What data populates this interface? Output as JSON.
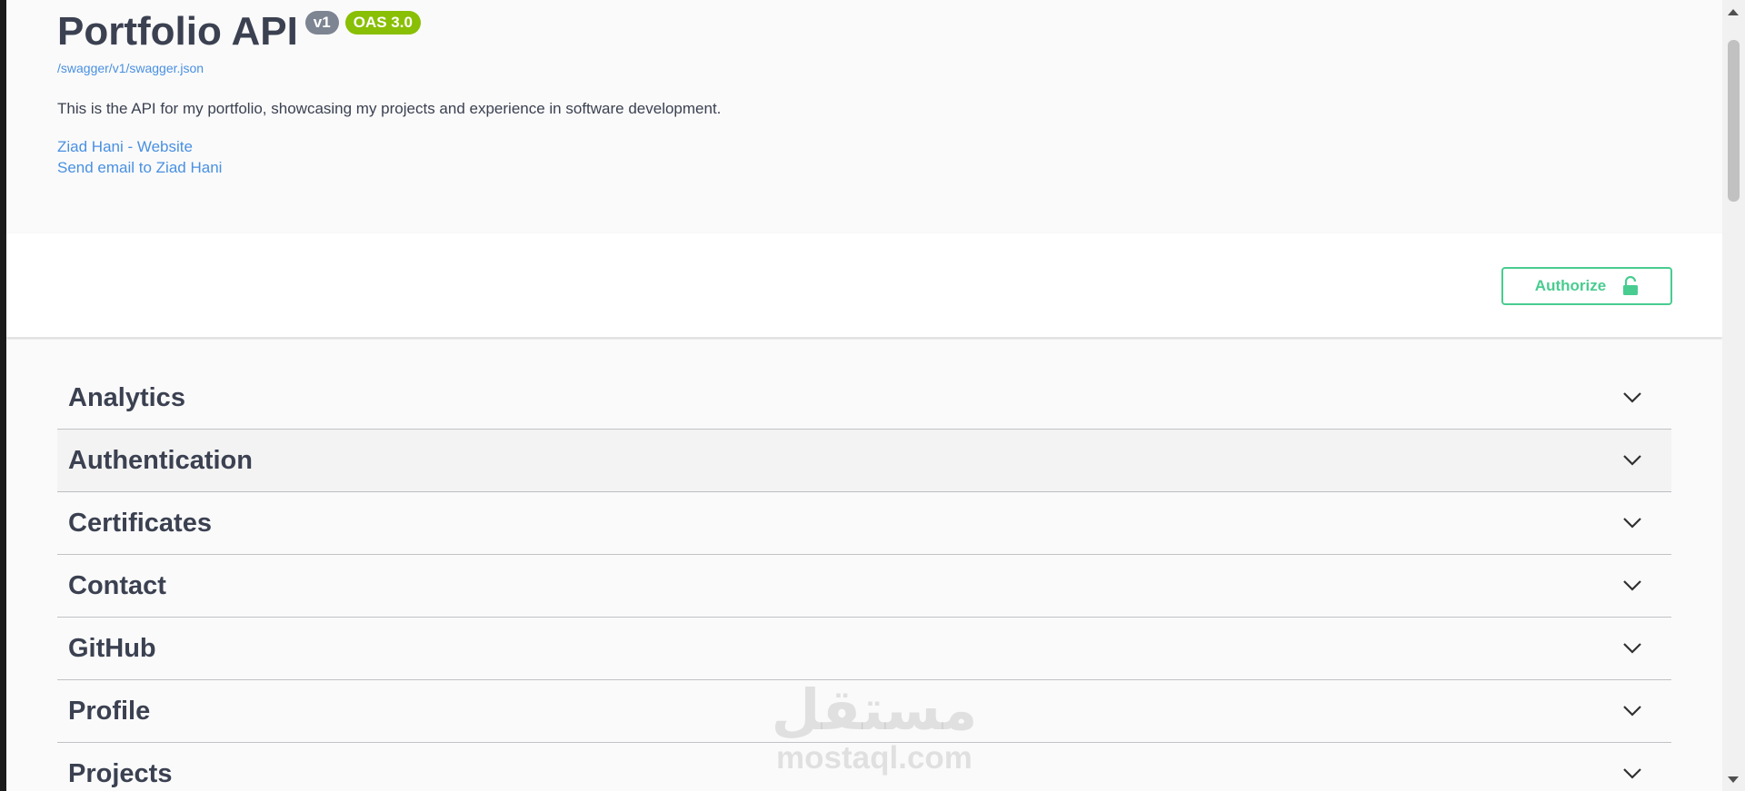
{
  "info": {
    "title": "Portfolio API",
    "version": "v1",
    "oas_version": "OAS 3.0",
    "spec_url": "/swagger/v1/swagger.json",
    "description": "This is the API for my portfolio, showcasing my projects and experience in software development.",
    "contact_website": "Ziad Hani - Website",
    "contact_email": "Send email to Ziad Hani"
  },
  "scheme": {
    "authorize_label": "Authorize"
  },
  "tags": [
    "Analytics",
    "Authentication",
    "Certificates",
    "Contact",
    "GitHub",
    "Profile",
    "Projects"
  ],
  "watermark": {
    "arabic": "مستقل",
    "latin": "mostaql.com"
  },
  "colors": {
    "accent_green": "#49cc90",
    "link_blue": "#4990e2",
    "oas_badge": "#89bf04",
    "text": "#3b4151"
  },
  "icons": {
    "authorize": "lock-icon",
    "tag_toggle": "chevron-down-icon"
  }
}
